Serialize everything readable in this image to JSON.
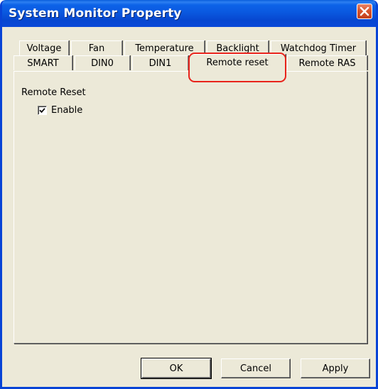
{
  "window": {
    "title": "System Monitor Property"
  },
  "tabs": {
    "row1": [
      {
        "label": "Voltage"
      },
      {
        "label": "Fan"
      },
      {
        "label": "Temperature"
      },
      {
        "label": "Backlight"
      },
      {
        "label": "Watchdog Timer"
      }
    ],
    "row2": [
      {
        "label": "SMART"
      },
      {
        "label": "DIN0"
      },
      {
        "label": "DIN1"
      },
      {
        "label": "Remote reset",
        "selected": true
      },
      {
        "label": "Remote RAS"
      }
    ]
  },
  "panel": {
    "group_label": "Remote Reset",
    "enable": {
      "label": "Enable",
      "checked": true
    }
  },
  "buttons": {
    "ok": "OK",
    "cancel": "Cancel",
    "apply": "Apply"
  },
  "colors": {
    "titlebar": "#0a59e0",
    "dialog_bg": "#ece9d8",
    "highlight_ring": "#e8231b"
  },
  "icons": {
    "close": "close-icon",
    "check": "checkmark-icon"
  }
}
